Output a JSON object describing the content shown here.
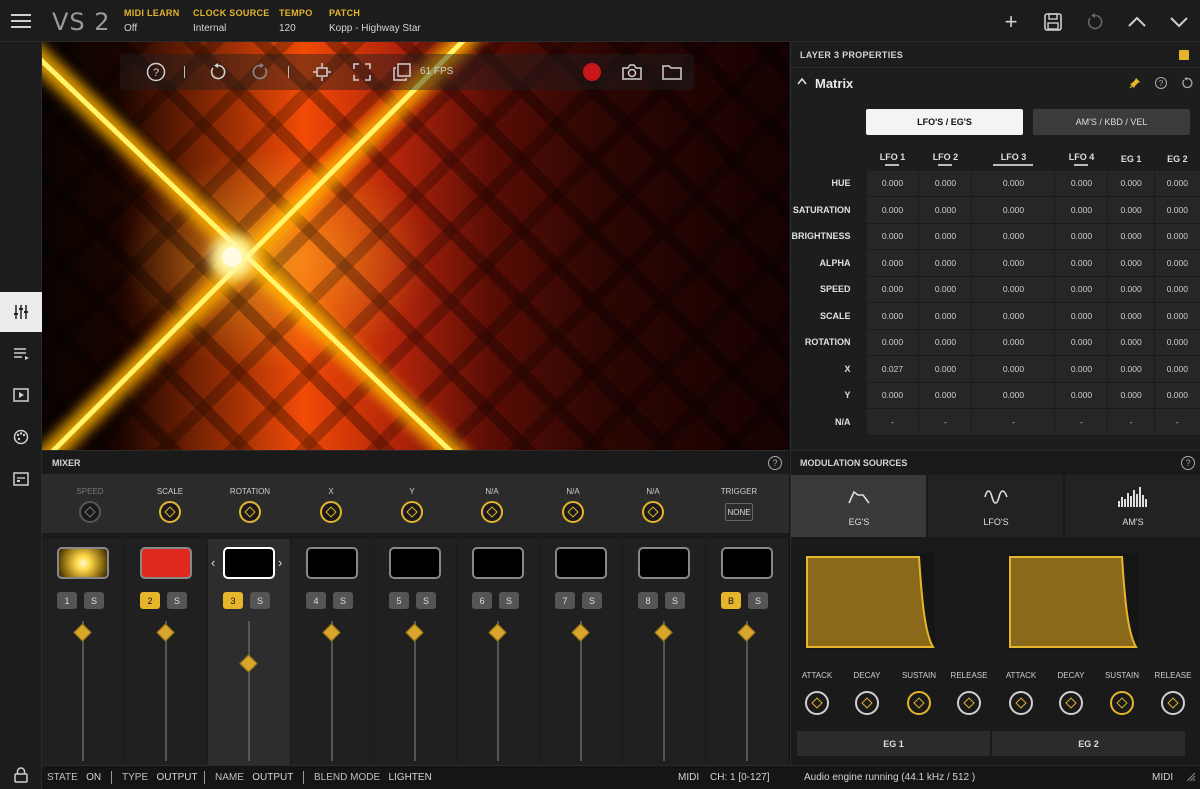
{
  "app": {
    "logo": "VS 2",
    "fields": [
      {
        "label": "MIDI LEARN",
        "value": "Off"
      },
      {
        "label": "CLOCK SOURCE",
        "value": "Internal"
      },
      {
        "label": "TEMPO",
        "value": "120"
      },
      {
        "label": "PATCH",
        "value": "Kopp - Highway Star"
      }
    ]
  },
  "canvas": {
    "fps": "61 FPS"
  },
  "layer_panel": {
    "title": "LAYER 3 PROPERTIES",
    "section": "Matrix",
    "tabs": [
      "LFO'S / EG'S",
      "AM'S / KBD / VEL"
    ],
    "columns": [
      "LFO 1",
      "LFO 2",
      "LFO 3",
      "LFO 4",
      "EG 1",
      "EG 2"
    ],
    "rows": [
      {
        "label": "HUE",
        "values": [
          "0.000",
          "0.000",
          "0.000",
          "0.000",
          "0.000",
          "0.000"
        ]
      },
      {
        "label": "SATURATION",
        "values": [
          "0.000",
          "0.000",
          "0.000",
          "0.000",
          "0.000",
          "0.000"
        ]
      },
      {
        "label": "BRIGHTNESS",
        "values": [
          "0.000",
          "0.000",
          "0.000",
          "0.000",
          "0.000",
          "0.000"
        ]
      },
      {
        "label": "ALPHA",
        "values": [
          "0.000",
          "0.000",
          "0.000",
          "0.000",
          "0.000",
          "0.000"
        ]
      },
      {
        "label": "SPEED",
        "values": [
          "0.000",
          "0.000",
          "0.000",
          "0.000",
          "0.000",
          "0.000"
        ]
      },
      {
        "label": "SCALE",
        "values": [
          "0.000",
          "0.000",
          "0.000",
          "0.000",
          "0.000",
          "0.000"
        ]
      },
      {
        "label": "ROTATION",
        "values": [
          "0.000",
          "0.000",
          "0.000",
          "0.000",
          "0.000",
          "0.000"
        ]
      },
      {
        "label": "X",
        "values": [
          "0.027",
          "0.000",
          "0.000",
          "0.000",
          "0.000",
          "0.000"
        ]
      },
      {
        "label": "Y",
        "values": [
          "0.000",
          "0.000",
          "0.000",
          "0.000",
          "0.000",
          "0.000"
        ]
      },
      {
        "label": "N/A",
        "values": [
          "-",
          "-",
          "-",
          "-",
          "-",
          "-"
        ]
      }
    ]
  },
  "mixer": {
    "title": "MIXER",
    "knobs": [
      "SPEED",
      "SCALE",
      "ROTATION",
      "X",
      "Y",
      "N/A",
      "N/A",
      "N/A"
    ],
    "trigger_label": "TRIGGER",
    "trigger_value": "NONE",
    "channels": [
      {
        "num": "1",
        "solo": "S",
        "active": false,
        "fader": 0.92
      },
      {
        "num": "2",
        "solo": "S",
        "active": true,
        "fader": 0.92
      },
      {
        "num": "3",
        "solo": "S",
        "active": true,
        "fader": 0.7
      },
      {
        "num": "4",
        "solo": "S",
        "active": false,
        "fader": 0.92
      },
      {
        "num": "5",
        "solo": "S",
        "active": false,
        "fader": 0.92
      },
      {
        "num": "6",
        "solo": "S",
        "active": false,
        "fader": 0.92
      },
      {
        "num": "7",
        "solo": "S",
        "active": false,
        "fader": 0.92
      },
      {
        "num": "8",
        "solo": "S",
        "active": false,
        "fader": 0.92
      },
      {
        "num": "B",
        "solo": "S",
        "active": true,
        "fader": 0.92
      }
    ]
  },
  "mod_sources": {
    "title": "MODULATION SOURCES",
    "tabs": [
      "EG'S",
      "LFO'S",
      "AM'S"
    ],
    "adsr": [
      "ATTACK",
      "DECAY",
      "SUSTAIN",
      "RELEASE",
      "ATTACK",
      "DECAY",
      "SUSTAIN",
      "RELEASE"
    ],
    "eg_tabs": [
      "EG 1",
      "EG 2"
    ]
  },
  "status": {
    "state_key": "STATE",
    "state_val": "ON",
    "type_key": "TYPE",
    "type_val": "OUTPUT",
    "name_key": "NAME",
    "name_val": "OUTPUT",
    "blend_key": "BLEND MODE",
    "blend_val": "LIGHTEN",
    "midi": "MIDI",
    "channel": "CH: 1  [0-127]",
    "engine": "Audio engine running (44.1 kHz / 512 )",
    "midi_right": "MIDI"
  },
  "colors": {
    "accent": "#e5b52b",
    "panel": "#1d1d1d"
  }
}
